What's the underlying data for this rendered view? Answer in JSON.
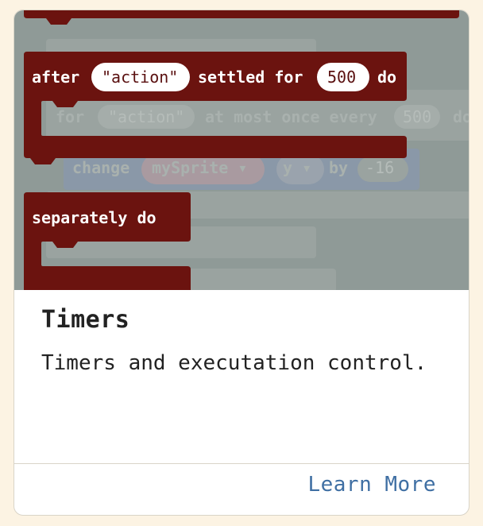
{
  "card": {
    "title": "Timers",
    "description": "Timers and executation control.",
    "action_label": "Learn More"
  },
  "preview": {
    "blocks": {
      "after_label": "after",
      "after_event": "\"action\"",
      "settled_label": "settled for",
      "settled_value": "500",
      "do_label": "do",
      "separately_label": "separately do"
    },
    "ghost": {
      "for_label": "for",
      "for_event": "\"action\"",
      "most_label": "at most once every",
      "most_value": "500",
      "most_tail": "do",
      "change_label": "change",
      "sprite_name": "mySprite ▾",
      "axis_name": "y ▾",
      "by_label": "by",
      "by_value": "-16"
    }
  },
  "colors": {
    "block": "#6b130f",
    "overlay": "#8f9a97",
    "page_background": "#fcf3e3",
    "link": "#3f6fa3"
  }
}
